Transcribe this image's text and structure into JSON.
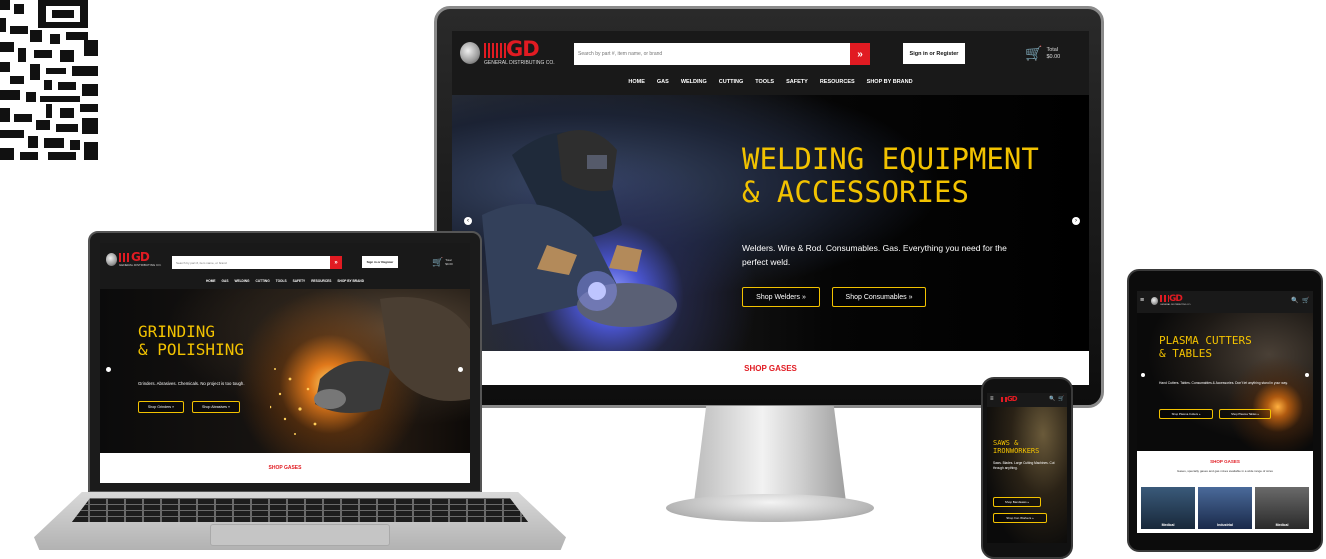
{
  "brand": {
    "logo_text": "GD",
    "logo_sub": "GENERAL DISTRIBUTING CO.",
    "red": "#e11b22",
    "yellow": "#f2c200"
  },
  "header": {
    "search_placeholder": "Search by part #, item name, or brand",
    "search_button": "»",
    "signin": "Sign in or Register",
    "cart_label": "Total",
    "cart_total": "$0.00"
  },
  "nav": [
    "HOME",
    "GAS",
    "WELDING",
    "CUTTING",
    "TOOLS",
    "SAFETY",
    "RESOURCES",
    "SHOP BY BRAND"
  ],
  "monitor": {
    "title_line1": "WELDING EQUIPMENT",
    "title_line2": "& ACCESSORIES",
    "subtitle": "Welders. Wire & Rod. Consumables. Gas. Everything you need for the perfect weld.",
    "btn1": "Shop Welders  »",
    "btn2": "Shop Consumables  »",
    "shop_bar": "SHOP GASES"
  },
  "laptop": {
    "title_line1": "GRINDING",
    "title_line2": "& POLISHING",
    "subtitle": "Grinders. Abrasives. Chemicals. No project is too tough.",
    "btn1": "Shop Grinders  »",
    "btn2": "Shop Abrasives  »",
    "shop_bar": "SHOP GASES"
  },
  "phone": {
    "title_line1": "SAWS &",
    "title_line2": "IRONWORKERS",
    "subtitle": "Saws. Blades. Large Cutting Machines. Cut through anything.",
    "btn1": "Shop Bandsaws  »",
    "btn2": "Shop Iron Workers  »"
  },
  "tablet": {
    "title_line1": "PLASMA CUTTERS",
    "title_line2": "& TABLES",
    "subtitle": "Hand Cutters. Tables. Consumables & Accessories. Don't let anything stand in your way.",
    "btn1": "Shop Plasma Cutters  »",
    "btn2": "Shop Plasma Tables  »",
    "shop_bar": "SHOP GASES",
    "shop_sub": "Gases, specialty gases and gas mixes available in a wide range of sizes",
    "categories": [
      "Medical",
      "Industrial",
      "Medical"
    ]
  },
  "icons": {
    "search": "magnifier",
    "cart": "cart",
    "menu": "hamburger",
    "prev": "chevron-left",
    "next": "chevron-right"
  }
}
